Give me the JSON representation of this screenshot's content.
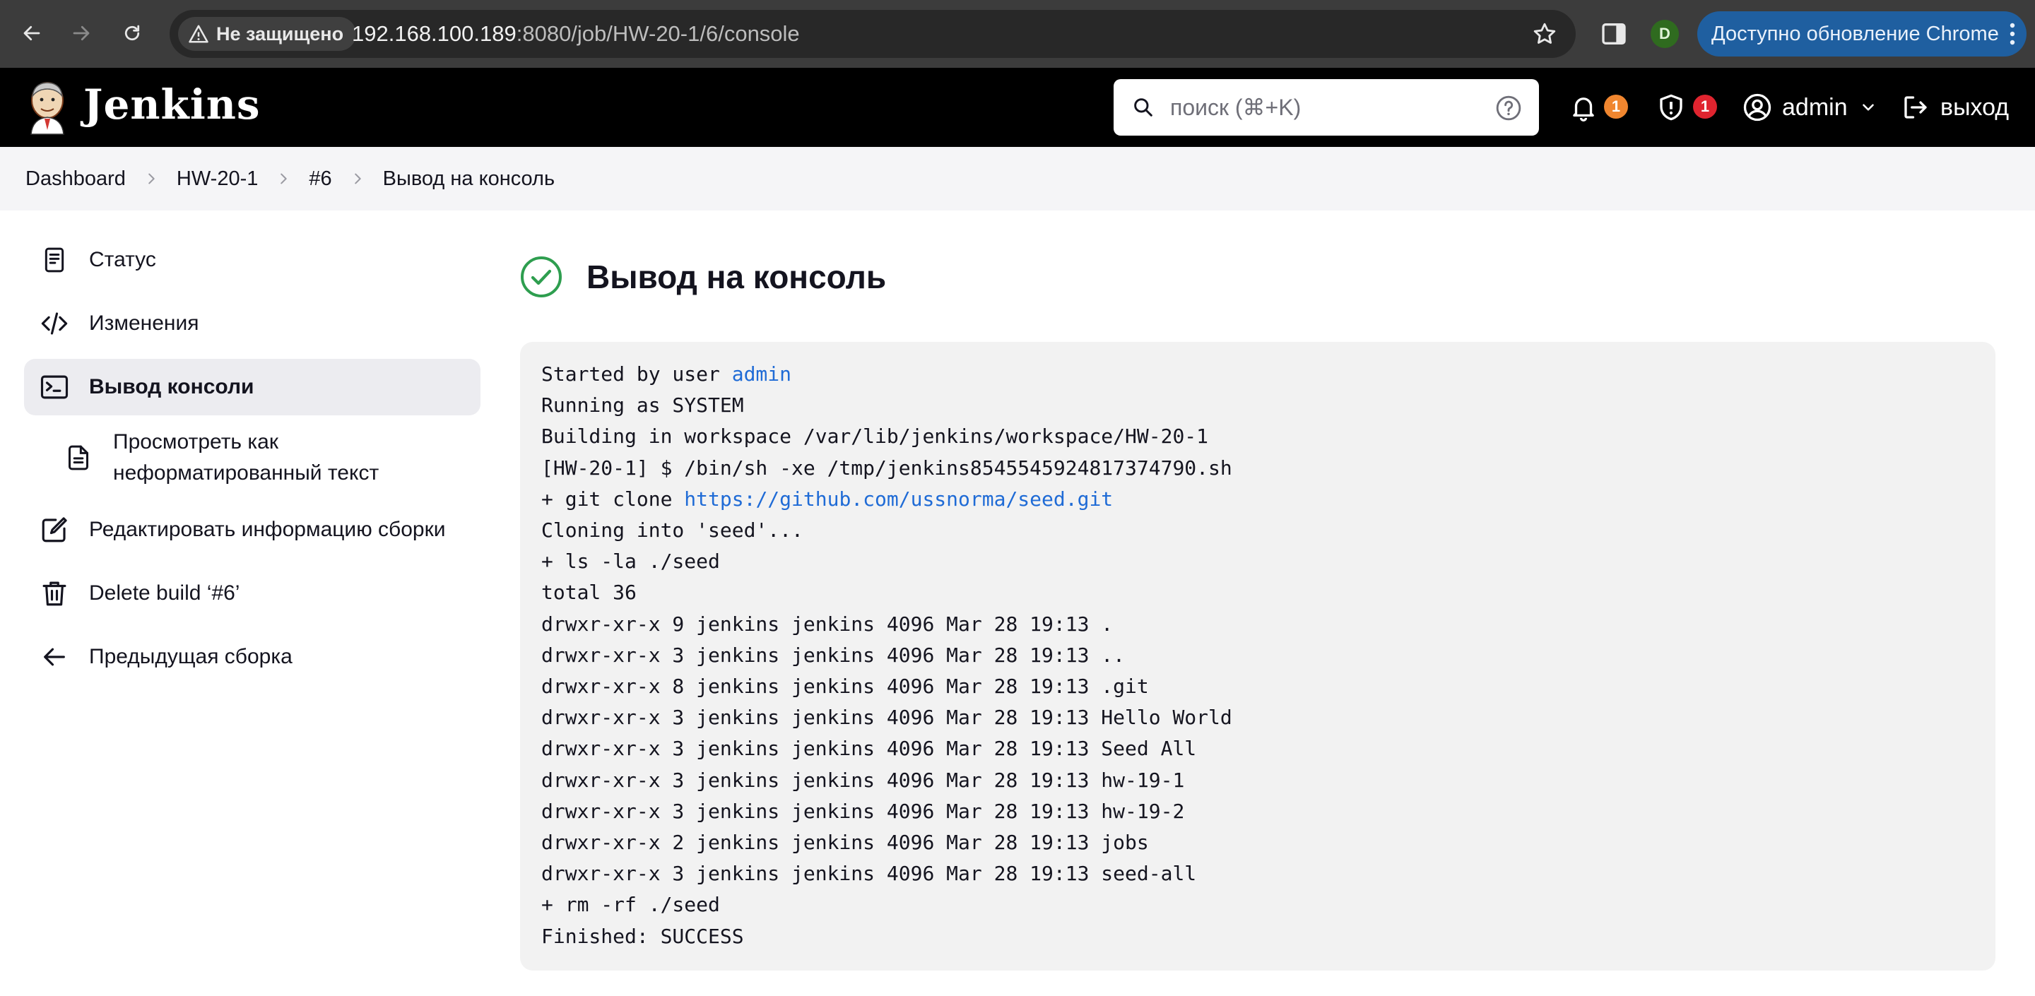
{
  "browser": {
    "security_label": "Не защищено",
    "url_host": "192.168.100.189",
    "url_rest": ":8080/job/HW-20-1/6/console",
    "profile_initial": "D",
    "update_label": "Доступно обновление Chrome"
  },
  "header": {
    "app_title": "Jenkins",
    "search_placeholder": "поиск (⌘+K)",
    "notifications_count": "1",
    "security_count": "1",
    "user_name": "admin",
    "logout_label": "выход",
    "colors": {
      "notif_badge": "#f0862f",
      "security_badge": "#e0242f"
    }
  },
  "breadcrumbs": [
    "Dashboard",
    "HW-20-1",
    "#6",
    "Вывод на консоль"
  ],
  "sidebar": {
    "items": [
      {
        "label": "Статус",
        "icon": "document-icon"
      },
      {
        "label": "Изменения",
        "icon": "code-icon"
      },
      {
        "label": "Вывод консоли",
        "icon": "terminal-icon",
        "active": true
      },
      {
        "label": "Просмотреть как неформатированный текст",
        "icon": "file-text-icon"
      },
      {
        "label": "Редактировать информацию сборки",
        "icon": "edit-icon"
      },
      {
        "label": "Delete build ‘#6’",
        "icon": "trash-icon"
      },
      {
        "label": "Предыдущая сборка",
        "icon": "arrow-left-icon"
      }
    ]
  },
  "main": {
    "title": "Вывод на консоль",
    "status_color": "#2e9e4f",
    "console": {
      "started_prefix": "Started by user ",
      "started_user": "admin",
      "lines_a": [
        "Running as SYSTEM",
        "Building in workspace /var/lib/jenkins/workspace/HW-20-1",
        "[HW-20-1] $ /bin/sh -xe /tmp/jenkins8545545924817374790.sh"
      ],
      "git_prefix": "+ git clone ",
      "git_url": "https://github.com/ussnorma/seed.git",
      "lines_b": [
        "Cloning into 'seed'...",
        "+ ls -la ./seed",
        "total 36",
        "drwxr-xr-x 9 jenkins jenkins 4096 Mar 28 19:13 .",
        "drwxr-xr-x 3 jenkins jenkins 4096 Mar 28 19:13 ..",
        "drwxr-xr-x 8 jenkins jenkins 4096 Mar 28 19:13 .git",
        "drwxr-xr-x 3 jenkins jenkins 4096 Mar 28 19:13 Hello World",
        "drwxr-xr-x 3 jenkins jenkins 4096 Mar 28 19:13 Seed All",
        "drwxr-xr-x 3 jenkins jenkins 4096 Mar 28 19:13 hw-19-1",
        "drwxr-xr-x 3 jenkins jenkins 4096 Mar 28 19:13 hw-19-2",
        "drwxr-xr-x 2 jenkins jenkins 4096 Mar 28 19:13 jobs",
        "drwxr-xr-x 3 jenkins jenkins 4096 Mar 28 19:13 seed-all",
        "+ rm -rf ./seed",
        "Finished: SUCCESS"
      ]
    }
  }
}
